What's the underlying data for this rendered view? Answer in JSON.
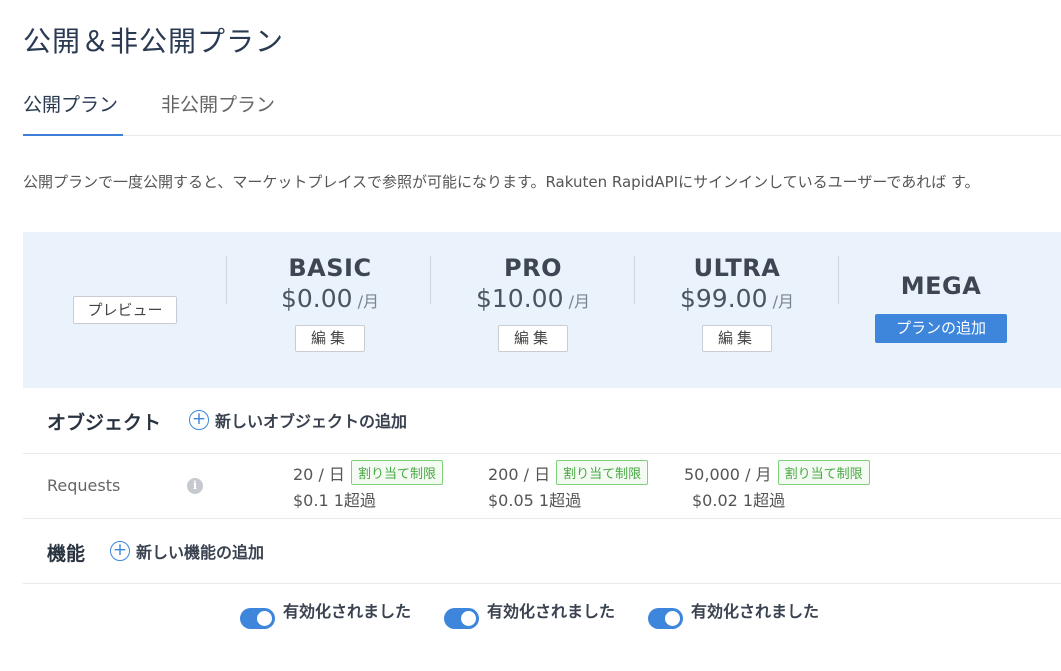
{
  "page": {
    "title": "公開＆非公開プラン"
  },
  "tabs": [
    {
      "label": "公開プラン",
      "active": true
    },
    {
      "label": "非公開プラン",
      "active": false
    }
  ],
  "description": "公開プランで一度公開すると、マーケットプレイスで参照が可能になります。Rakuten RapidAPIにサインインしているユーザーであれば す。",
  "preview_label": "プレビュー",
  "plans": [
    {
      "name": "BASIC",
      "price": "$0.00",
      "unit": "/月",
      "edit_label": "編集"
    },
    {
      "name": "PRO",
      "price": "$10.00",
      "unit": "/月",
      "edit_label": "編集"
    },
    {
      "name": "ULTRA",
      "price": "$99.00",
      "unit": "/月",
      "edit_label": "編集"
    },
    {
      "name": "MEGA",
      "add_label": "プランの追加"
    }
  ],
  "objects": {
    "title": "オブジェクト",
    "add_label": "新しいオブジェクトの追加"
  },
  "requests": {
    "label": "Requests",
    "info_icon": "info-icon",
    "quotas": [
      {
        "limit": "20 / 日",
        "badge": "割り当て制限",
        "overage": "$0.1 1超過"
      },
      {
        "limit": "200 / 日",
        "badge": "割り当て制限",
        "overage": "$0.05 1超過"
      },
      {
        "limit": "50,000 / 月",
        "badge": "割り当て制限",
        "overage": "$0.02 1超過"
      }
    ]
  },
  "features": {
    "title": "機能",
    "add_label": "新しい機能の追加"
  },
  "toggles": [
    {
      "label": "有効化されました",
      "on": true
    },
    {
      "label": "有効化されました",
      "on": true
    },
    {
      "label": "有効化されました",
      "on": true
    }
  ],
  "colors": {
    "accent": "#3d86db",
    "header_bg": "#eaf3fc",
    "badge_green": "#4aa845"
  }
}
